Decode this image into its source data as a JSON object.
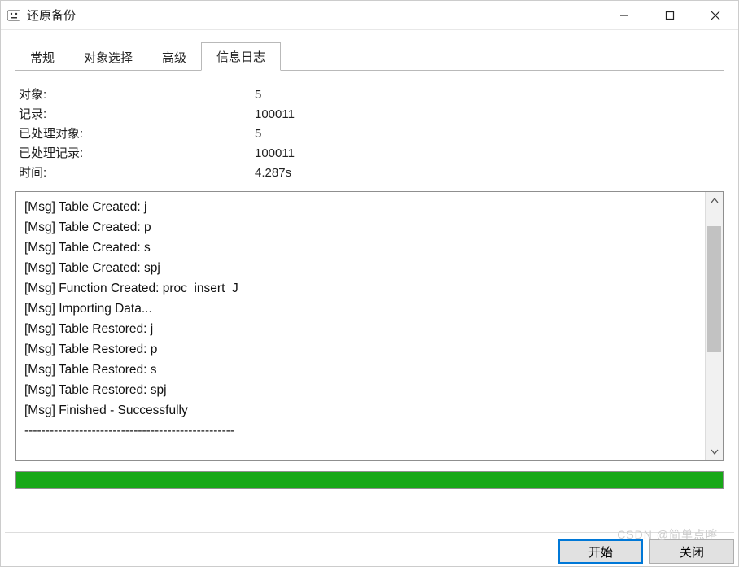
{
  "window": {
    "title": "还原备份"
  },
  "tabs": [
    {
      "label": "常规"
    },
    {
      "label": "对象选择"
    },
    {
      "label": "高级"
    },
    {
      "label": "信息日志"
    }
  ],
  "active_tab_index": 3,
  "stats": [
    {
      "label": "对象:",
      "value": "5"
    },
    {
      "label": "记录:",
      "value": "100011"
    },
    {
      "label": "已处理对象:",
      "value": "5"
    },
    {
      "label": "已处理记录:",
      "value": "100011"
    },
    {
      "label": "时间:",
      "value": "4.287s"
    }
  ],
  "log_lines": [
    "[Msg] Table Created: j",
    "[Msg] Table Created: p",
    "[Msg] Table Created: s",
    "[Msg] Table Created: spj",
    "[Msg] Function Created: proc_insert_J",
    "[Msg] Importing Data...",
    "[Msg] Table Restored: j",
    "[Msg] Table Restored: p",
    "[Msg] Table Restored: s",
    "[Msg] Table Restored: spj",
    "[Msg] Finished - Successfully",
    "--------------------------------------------------"
  ],
  "progress_percent": 100,
  "progress_color": "#17a817",
  "buttons": {
    "start": "开始",
    "close": "关闭"
  },
  "watermark": "CSDN @简单点喀"
}
